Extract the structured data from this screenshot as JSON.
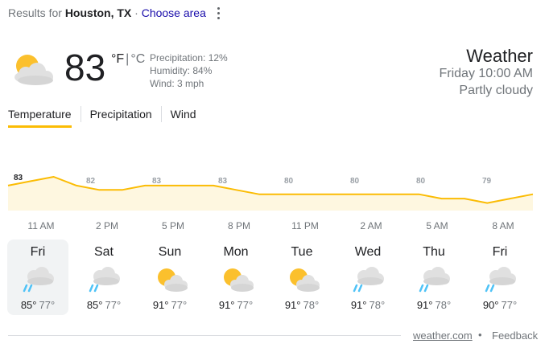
{
  "header": {
    "results_prefix": "Results for",
    "location": "Houston, TX",
    "separator": "·",
    "choose_area": "Choose area"
  },
  "current": {
    "temperature": "83",
    "unit_f": "°F",
    "unit_sep": "|",
    "unit_c": "°C",
    "precipitation": "Precipitation: 12%",
    "humidity": "Humidity: 84%",
    "wind": "Wind: 3 mph",
    "icon": "partly-cloudy-icon",
    "title": "Weather",
    "datetime": "Friday 10:00 AM",
    "condition": "Partly cloudy"
  },
  "tabs": [
    {
      "label": "Temperature",
      "active": true
    },
    {
      "label": "Precipitation",
      "active": false
    },
    {
      "label": "Wind",
      "active": false
    }
  ],
  "chart_data": {
    "type": "area",
    "x": [
      "11 AM",
      "2 PM",
      "5 PM",
      "8 PM",
      "11 PM",
      "2 AM",
      "5 AM",
      "8 AM"
    ],
    "labels": [
      "83",
      "82",
      "83",
      "83",
      "80",
      "80",
      "80",
      "79"
    ],
    "hourly_temps": [
      82,
      83,
      84,
      82,
      81,
      81,
      82,
      82,
      82,
      82,
      81,
      80,
      80,
      80,
      80,
      80,
      80,
      80,
      80,
      79,
      79,
      78,
      79,
      80
    ],
    "color_line": "#fbbc04",
    "color_fill": "#fef7e0"
  },
  "days": [
    {
      "name": "Fri",
      "icon": "rain-cloud-icon",
      "high": "85°",
      "low": "77°",
      "selected": true
    },
    {
      "name": "Sat",
      "icon": "rain-cloud-icon",
      "high": "85°",
      "low": "77°",
      "selected": false
    },
    {
      "name": "Sun",
      "icon": "partly-cloudy-icon",
      "high": "91°",
      "low": "77°",
      "selected": false
    },
    {
      "name": "Mon",
      "icon": "partly-cloudy-icon",
      "high": "91°",
      "low": "77°",
      "selected": false
    },
    {
      "name": "Tue",
      "icon": "partly-cloudy-icon",
      "high": "91°",
      "low": "78°",
      "selected": false
    },
    {
      "name": "Wed",
      "icon": "rain-cloud-icon",
      "high": "91°",
      "low": "78°",
      "selected": false
    },
    {
      "name": "Thu",
      "icon": "rain-cloud-icon",
      "high": "91°",
      "low": "78°",
      "selected": false
    },
    {
      "name": "Fri",
      "icon": "rain-cloud-icon",
      "high": "90°",
      "low": "77°",
      "selected": false
    }
  ],
  "footer": {
    "source": "weather.com",
    "dot": "•",
    "feedback": "Feedback"
  }
}
